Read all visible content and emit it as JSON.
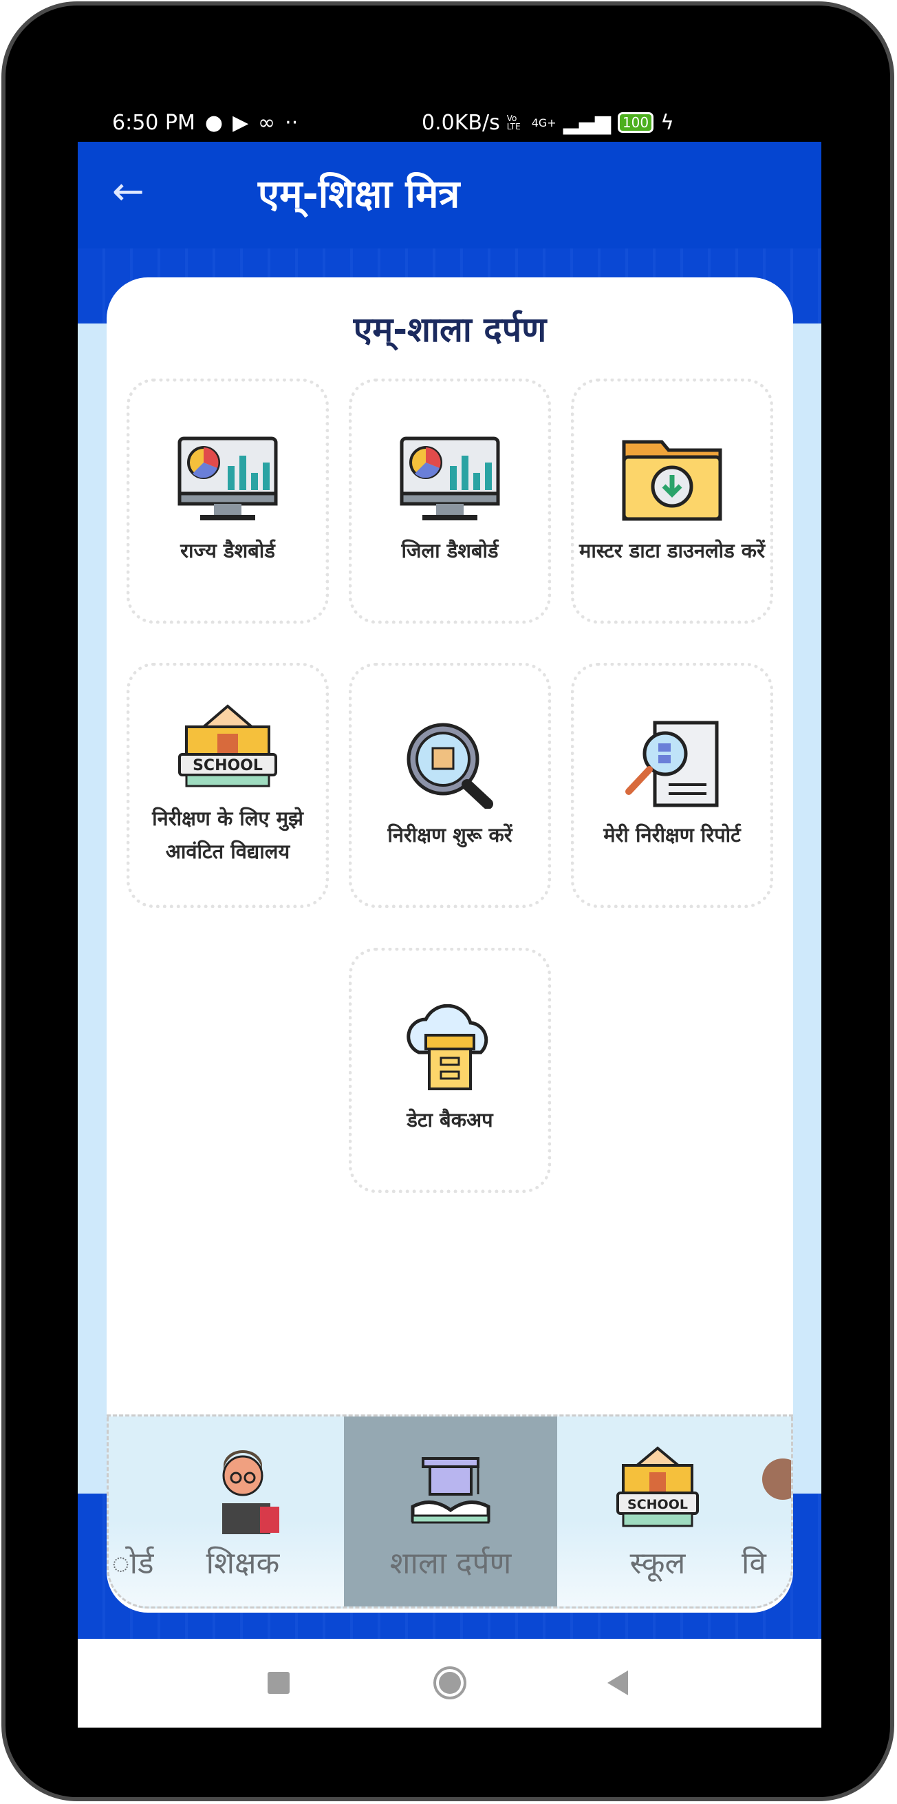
{
  "status_bar": {
    "time": "6:50 PM",
    "speed": "0.0KB/s",
    "network": "4G+",
    "volte": "Vo LTE",
    "battery": "100"
  },
  "app_bar": {
    "title": "एम्-शिक्षा मित्र",
    "back_icon": "arrow-left-icon"
  },
  "card": {
    "title": "एम्-शाला दर्पण",
    "tiles": [
      {
        "label": "राज्य डैशबोर्ड",
        "icon": "dashboard-monitor-icon"
      },
      {
        "label": "जिला डैशबोर्ड",
        "icon": "dashboard-monitor-icon"
      },
      {
        "label": "मास्टर डाटा डाउनलोड करें",
        "icon": "folder-download-icon"
      },
      {
        "label": "निरीक्षण के लिए मुझे आवंटित विद्यालय",
        "icon": "school-icon"
      },
      {
        "label": "निरीक्षण शुरू करें",
        "icon": "magnifier-icon"
      },
      {
        "label": "मेरी निरीक्षण रिपोर्ट",
        "icon": "report-search-icon"
      },
      {
        "label": "डेटा बैकअप",
        "icon": "cloud-backup-icon"
      }
    ]
  },
  "bottom_nav": {
    "items": [
      {
        "label": "ोर्ड",
        "icon": "dashboard-icon"
      },
      {
        "label": "शिक्षक",
        "icon": "teacher-icon"
      },
      {
        "label": "शाला दर्पण",
        "icon": "graduation-book-icon",
        "selected": true
      },
      {
        "label": "स्कूल",
        "icon": "school-icon"
      },
      {
        "label": "वि",
        "icon": "student-icon"
      }
    ]
  },
  "colors": {
    "app_bar": "#0545d0",
    "selected_nav": "#95a8b2",
    "title": "#1b2a5e"
  }
}
